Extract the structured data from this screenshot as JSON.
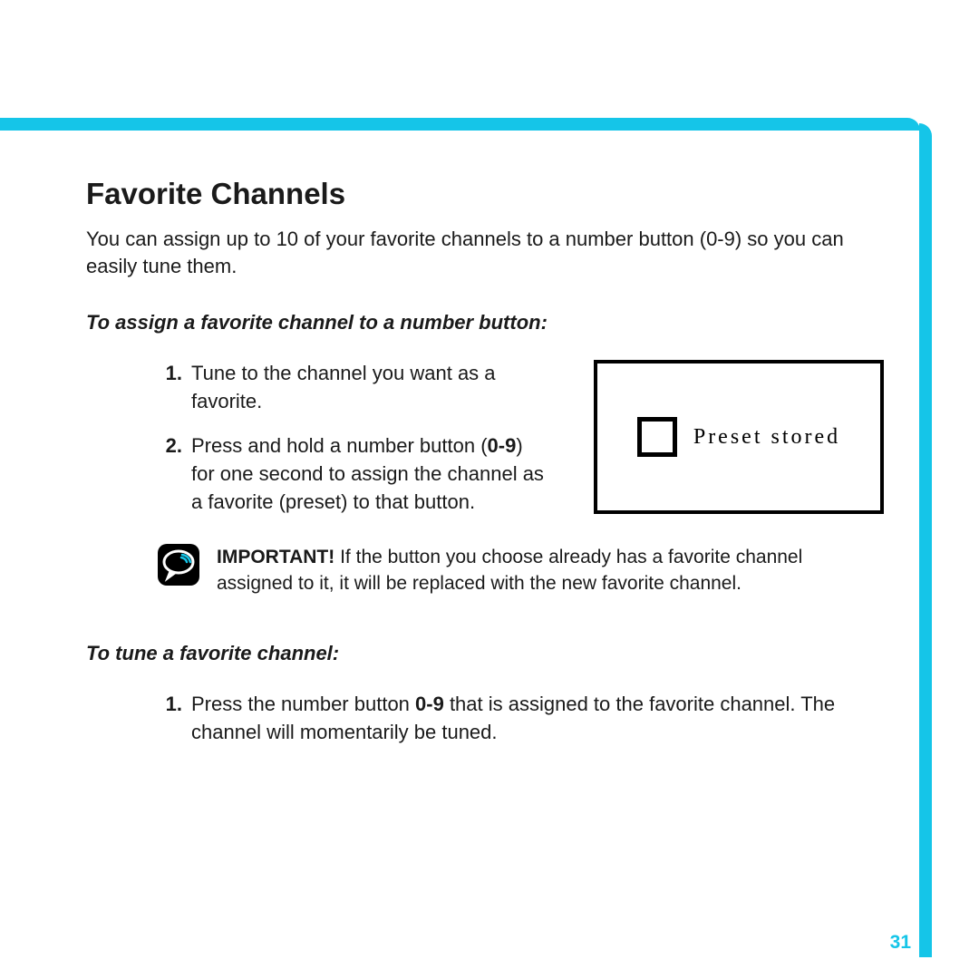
{
  "heading": "Favorite Channels",
  "intro": "You can assign up to 10 of your favorite channels to a number button (0-9) so you can easily tune them.",
  "section_assign": {
    "subhead": "To assign a favorite channel to a number button:",
    "items": [
      {
        "num": "1.",
        "text": "Tune to the channel you want as a favorite."
      },
      {
        "num": "2.",
        "prefix": "Press and hold a number button (",
        "bold": "0-9",
        "suffix": ") for one second to assign the channel as a favorite (preset) to that button."
      }
    ],
    "display_label": "Preset stored"
  },
  "note": {
    "label": "IMPORTANT!",
    "text": " If the button you choose already has a favorite channel assigned to it, it will be replaced with the new favorite channel."
  },
  "section_tune": {
    "subhead": "To tune a favorite channel:",
    "items": [
      {
        "num": "1.",
        "prefix": "Press the number button ",
        "bold": "0-9",
        "suffix": " that is assigned to the favorite channel. The channel will momentarily be tuned."
      }
    ]
  },
  "page_number": "31"
}
